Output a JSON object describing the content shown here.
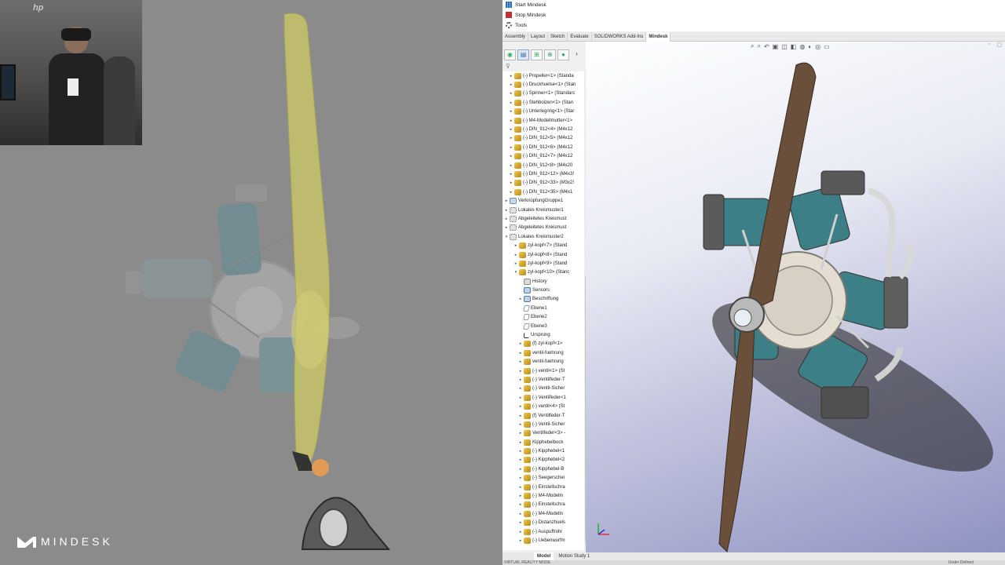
{
  "vr": {
    "webcam_sign": "hp",
    "logo_text": "MINDESK"
  },
  "mindesk_menu": [
    {
      "label": "Start Mindesk",
      "icon": "bar-chart-icon"
    },
    {
      "label": "Stop Mindesk",
      "icon": "stop-icon"
    },
    {
      "label": "Tools",
      "icon": "gear-icon"
    }
  ],
  "ribbon_tabs": [
    {
      "label": "Assembly",
      "active": false
    },
    {
      "label": "Layout",
      "active": false
    },
    {
      "label": "Sketch",
      "active": false
    },
    {
      "label": "Evaluate",
      "active": false
    },
    {
      "label": "SOLIDWORKS Add-Ins",
      "active": false
    },
    {
      "label": "Mindesk",
      "active": true
    }
  ],
  "tree": [
    {
      "label": "(-) Propeller<1> (Standa",
      "indent": 1,
      "icon": "part",
      "arrow": "▸"
    },
    {
      "label": "(-) Druckhuelse<1> (Stan",
      "indent": 1,
      "icon": "part",
      "arrow": "▸"
    },
    {
      "label": "(-) Spinner<1> (Standarc",
      "indent": 1,
      "icon": "part",
      "arrow": "▸"
    },
    {
      "label": "(-) Stehbolzen<1> (Stan",
      "indent": 1,
      "icon": "part",
      "arrow": "▸"
    },
    {
      "label": "(-) Unterlegring<1> (Star",
      "indent": 1,
      "icon": "part",
      "arrow": "▸"
    },
    {
      "label": "(-) M4-Modellmutter<1>",
      "indent": 1,
      "icon": "part",
      "arrow": "▸"
    },
    {
      "label": "(-) DIN_912<4> (M4x12",
      "indent": 1,
      "icon": "part",
      "arrow": "▸"
    },
    {
      "label": "(-) DIN_912<5> (M4x12",
      "indent": 1,
      "icon": "part",
      "arrow": "▸"
    },
    {
      "label": "(-) DIN_912<6> (M4x12",
      "indent": 1,
      "icon": "part",
      "arrow": "▸"
    },
    {
      "label": "(-) DIN_912<7> (M4x12",
      "indent": 1,
      "icon": "part",
      "arrow": "▸"
    },
    {
      "label": "(-) DIN_912<8> (M4x20",
      "indent": 1,
      "icon": "part",
      "arrow": "▸"
    },
    {
      "label": "(-) DIN_912<12> (M4x3!",
      "indent": 1,
      "icon": "part",
      "arrow": "▸"
    },
    {
      "label": "(-) DIN_912<33> (M3x2!",
      "indent": 1,
      "icon": "part",
      "arrow": "▸"
    },
    {
      "label": "(-) DIN_912<35> (M4x1",
      "indent": 1,
      "icon": "part",
      "arrow": "▸"
    },
    {
      "label": "VerknüpfungGruppe1",
      "indent": 0,
      "icon": "mate",
      "arrow": "▸"
    },
    {
      "label": "Lokales Kreismuster1",
      "indent": 0,
      "icon": "pattern",
      "arrow": "▸"
    },
    {
      "label": "Abgeleitetes Kreismust",
      "indent": 0,
      "icon": "pattern",
      "arrow": "▸"
    },
    {
      "label": "Abgeleitetes Kreismust",
      "indent": 0,
      "icon": "pattern",
      "arrow": "▸"
    },
    {
      "label": "Lokales Kreismuster2",
      "indent": 0,
      "icon": "pattern",
      "arrow": "▾"
    },
    {
      "label": "zyl-kopf<7> (Stand",
      "indent": 2,
      "icon": "part",
      "arrow": "▸"
    },
    {
      "label": "zyl-kopf<8> (Stand",
      "indent": 2,
      "icon": "part",
      "arrow": "▸"
    },
    {
      "label": "zyl-kopf<9> (Stand",
      "indent": 2,
      "icon": "part",
      "arrow": "▸"
    },
    {
      "label": "zyl-kopf<10> (Stanc",
      "indent": 2,
      "icon": "part",
      "arrow": "▾"
    },
    {
      "label": "History",
      "indent": 3,
      "icon": "folder",
      "arrow": ""
    },
    {
      "label": "Sensors",
      "indent": 3,
      "icon": "sensor",
      "arrow": ""
    },
    {
      "label": "Beschriftung",
      "indent": 3,
      "icon": "sensor",
      "arrow": "▸"
    },
    {
      "label": "Ebene1",
      "indent": 3,
      "icon": "plane",
      "arrow": ""
    },
    {
      "label": "Ebene2",
      "indent": 3,
      "icon": "plane",
      "arrow": ""
    },
    {
      "label": "Ebene3",
      "indent": 3,
      "icon": "plane",
      "arrow": ""
    },
    {
      "label": "Ursprung",
      "indent": 3,
      "icon": "origin",
      "arrow": ""
    },
    {
      "label": "(f) zyl-kopf<1>",
      "indent": 3,
      "icon": "part",
      "arrow": "▸"
    },
    {
      "label": "ventil-fuehrung",
      "indent": 3,
      "icon": "part",
      "arrow": "▸"
    },
    {
      "label": "ventil-fuehrung",
      "indent": 3,
      "icon": "part",
      "arrow": "▸"
    },
    {
      "label": "(-) ventil<1> (St",
      "indent": 3,
      "icon": "part",
      "arrow": "▸"
    },
    {
      "label": "(-) Ventilfeder-T",
      "indent": 3,
      "icon": "part",
      "arrow": "▸"
    },
    {
      "label": "(-) Ventil-Sicher",
      "indent": 3,
      "icon": "part",
      "arrow": "▸"
    },
    {
      "label": "(-) Ventilfeder<1",
      "indent": 3,
      "icon": "part",
      "arrow": "▸"
    },
    {
      "label": "(-) ventil<4> (St",
      "indent": 3,
      "icon": "part",
      "arrow": "▸"
    },
    {
      "label": "(f) Ventilfeder-T",
      "indent": 3,
      "icon": "part",
      "arrow": "▸"
    },
    {
      "label": "(-) Ventil-Sicher",
      "indent": 3,
      "icon": "part",
      "arrow": "▸"
    },
    {
      "label": "Ventilfeder<3> -",
      "indent": 3,
      "icon": "part",
      "arrow": "▸"
    },
    {
      "label": "Kipphebelbock",
      "indent": 3,
      "icon": "part",
      "arrow": "▸"
    },
    {
      "label": "(-) Kipphebel<1",
      "indent": 3,
      "icon": "part",
      "arrow": "▸"
    },
    {
      "label": "(-) Kipphebel<2",
      "indent": 3,
      "icon": "part",
      "arrow": "▸"
    },
    {
      "label": "(-) Kipphebel-B",
      "indent": 3,
      "icon": "part",
      "arrow": "▸"
    },
    {
      "label": "(-) Seegerschei",
      "indent": 3,
      "icon": "part",
      "arrow": "▸"
    },
    {
      "label": "(-) Einstellschra",
      "indent": 3,
      "icon": "part",
      "arrow": "▸"
    },
    {
      "label": "(-) M4-Modelln",
      "indent": 3,
      "icon": "part",
      "arrow": "▸"
    },
    {
      "label": "(-) Einstellschra",
      "indent": 3,
      "icon": "part",
      "arrow": "▸"
    },
    {
      "label": "(-) M4-Modelln",
      "indent": 3,
      "icon": "part",
      "arrow": "▸"
    },
    {
      "label": "(-) Distanzhuels",
      "indent": 3,
      "icon": "part",
      "arrow": "▸"
    },
    {
      "label": "(-) Auspuffrohr",
      "indent": 3,
      "icon": "part",
      "arrow": "▸"
    },
    {
      "label": "(-) Uebenwurfm",
      "indent": 3,
      "icon": "part",
      "arrow": "▸"
    }
  ],
  "bottom_tabs": [
    {
      "label": "Model",
      "active": true
    },
    {
      "label": "Motion Study 1",
      "active": false
    }
  ],
  "status": {
    "left": "VIRTUAL REALITY MODE",
    "right": "Under Defined"
  },
  "colors": {
    "accent": "#3a6ea5",
    "propeller_vr": "#c8c469",
    "propeller_sw": "#6a4f3a",
    "cylinder": "#3d7f87"
  }
}
